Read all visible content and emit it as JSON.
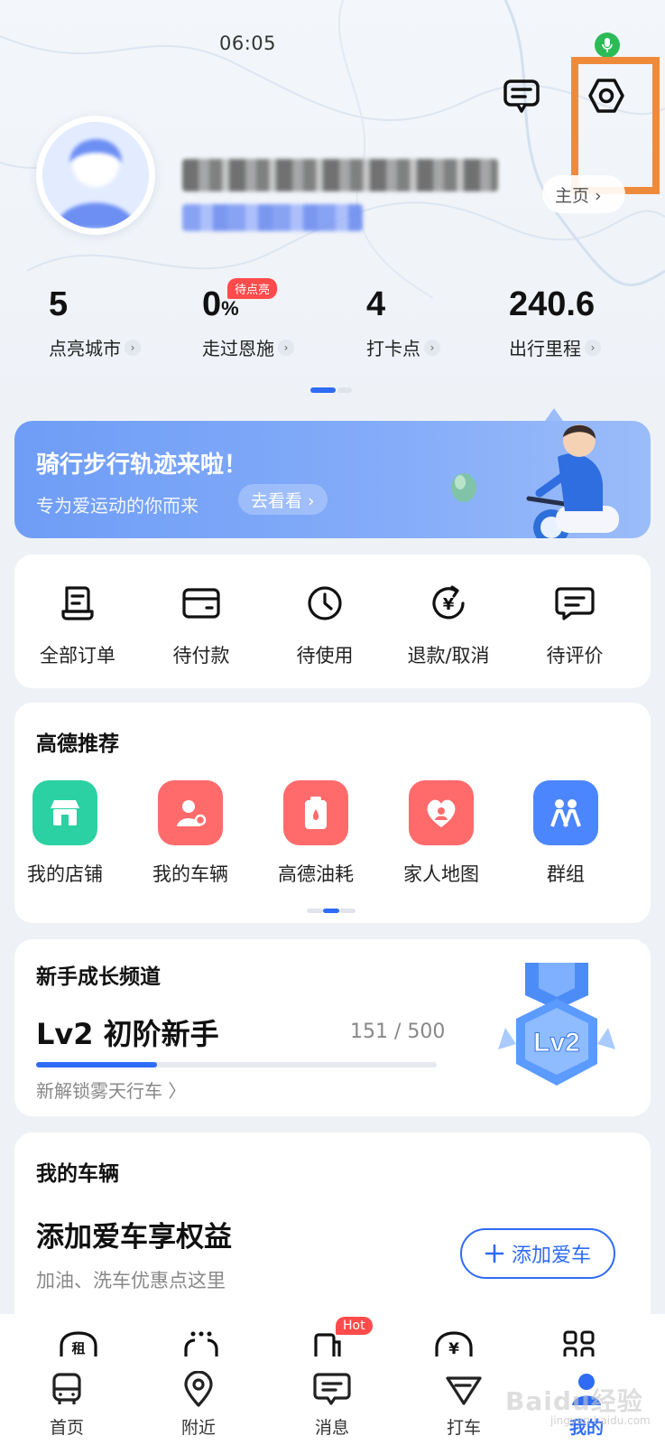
{
  "status_bar": {
    "time": "06:05"
  },
  "header": {
    "homepage_label": "主页 ›"
  },
  "stats": [
    {
      "value": "5",
      "unit": "",
      "label": "点亮城市"
    },
    {
      "value": "0",
      "unit": "%",
      "label": "走过恩施",
      "badge": "待点亮"
    },
    {
      "value": "4",
      "unit": "",
      "label": "打卡点"
    },
    {
      "value": "240.6",
      "unit": "",
      "label": "出行里程"
    }
  ],
  "banner": {
    "title": "骑行步行轨迹来啦！",
    "subtitle": "专为爱运动的你而来",
    "button": "去看看 ›"
  },
  "orders": [
    {
      "label": "全部订单",
      "icon": "order-list-icon"
    },
    {
      "label": "待付款",
      "icon": "wallet-icon"
    },
    {
      "label": "待使用",
      "icon": "clock-icon"
    },
    {
      "label": "退款/取消",
      "icon": "refund-icon"
    },
    {
      "label": "待评价",
      "icon": "comment-icon"
    }
  ],
  "recommend": {
    "title": "高德推荐",
    "items": [
      {
        "label": "我的店铺",
        "icon": "store-icon",
        "color": "#2bd1a3"
      },
      {
        "label": "我的车辆",
        "icon": "car-owner-icon",
        "color": "#ff6b6b"
      },
      {
        "label": "高德油耗",
        "icon": "fuel-icon",
        "color": "#ff6b6b"
      },
      {
        "label": "家人地图",
        "icon": "family-heart-icon",
        "color": "#ff6b6b"
      },
      {
        "label": "群组",
        "icon": "group-icon",
        "color": "#4c86ff"
      }
    ]
  },
  "growth": {
    "title": "新手成长频道",
    "level": "Lv2 初阶新手",
    "progress_text": "151 / 500",
    "progress_fraction": 0.302,
    "link": "新解锁雾天行车 〉",
    "medal_text": "Lv2"
  },
  "vehicle": {
    "title": "我的车辆",
    "headline": "添加爱车享权益",
    "subtitle": "加油、洗车优惠点这里",
    "button": "添加爱车"
  },
  "services": {
    "rent_label": "租",
    "hot_badge": "Hot",
    "yen_label": "¥"
  },
  "bottom_nav": [
    {
      "label": "首页",
      "icon": "home-bus-icon"
    },
    {
      "label": "附近",
      "icon": "location-pin-icon"
    },
    {
      "label": "消息",
      "icon": "message-icon"
    },
    {
      "label": "打车",
      "icon": "taxi-icon"
    },
    {
      "label": "我的",
      "icon": "profile-icon",
      "active": true
    }
  ],
  "watermark": {
    "text": "Baidu经验",
    "sub": "jingyan.baidu.com"
  },
  "colors": {
    "accent": "#2f6cf6",
    "highlight": "#f08a3b",
    "badge": "#ff4b4b"
  }
}
